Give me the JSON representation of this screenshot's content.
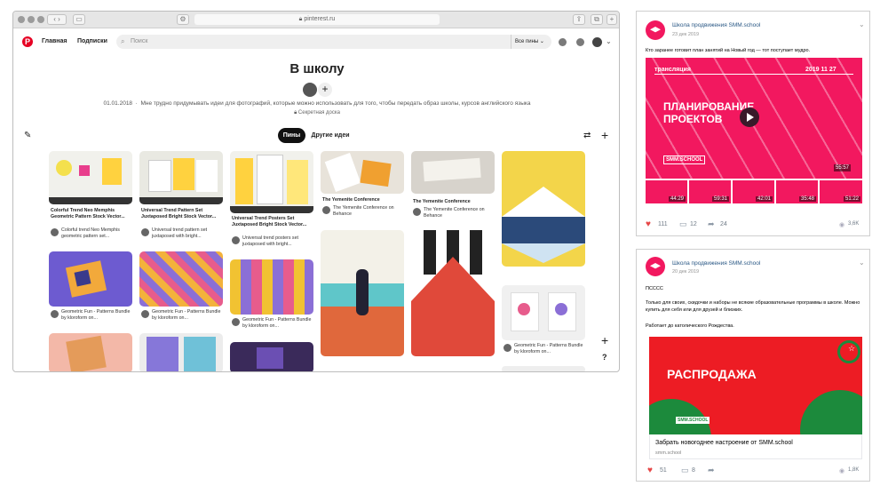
{
  "browser": {
    "url": "pinterest.ru"
  },
  "pinterest": {
    "nav": {
      "home": "Главная",
      "following": "Подписки",
      "search_placeholder": "Поиск",
      "all_pins": "Все пины"
    },
    "board": {
      "title": "В школу",
      "date": "01.01.2018",
      "description": "Мне трудно придумывать идеи для фотографий, которые можно использовать для того, чтобы передать образ школы, курсов английского языка",
      "secret": "Секретная доска"
    },
    "tabs": {
      "pins": "Пины",
      "other": "Другие идеи"
    },
    "help": "?",
    "pins": [
      {
        "title": "Colorful Trend Neo Memphis Geometric Pattern Stock Vector...",
        "sub": "Colorful trend Neo Memphis geometric pattern set..."
      },
      {
        "title": "Universal Trend Pattern Set Juxtaposed Bright Stock Vector...",
        "sub": "Universal trend pattern set juxtaposed with bright..."
      },
      {
        "title": "Universal Trend Posters Set Juxtaposed Bright Stock Vector...",
        "sub": "Universal trend posters set juxtaposed with bright..."
      },
      {
        "title": "The Yemenite Conference",
        "sub": "The Yemenite Conference on Behance"
      },
      {
        "title": "The Yemenite Conference",
        "sub": "The Yemenite Conference on Behance"
      },
      {
        "title": "",
        "sub": "Geometric Fun - Patterns Bundle by kloroform on..."
      },
      {
        "title": "",
        "sub": "Geometric Fun - Patterns Bundle by kloroform on..."
      },
      {
        "title": "",
        "sub": "Geometric Fun - Patterns Bundle by kloroform on..."
      },
      {
        "title": "",
        "sub": "Geometric Fun - Patterns Bundle by kloroform on..."
      }
    ]
  },
  "post1": {
    "author": "Школа продвижения SMM.school",
    "date": "23 дек 2019",
    "text": "Кто заранее готовит план занятий на Новый год — тот поступает мудро.",
    "video": {
      "badge": "трансляция",
      "vdate": "2019 11 27",
      "title1": "ПЛАНИРОВАНИЕ",
      "title2": "ПРОЕКТОВ",
      "logo": "SMM.SCHOOL",
      "duration": "55:57"
    },
    "thumbs": [
      "44:29",
      "59:31",
      "42:01",
      "35:48",
      "51:22"
    ],
    "likes": "111",
    "comments": "12",
    "reposts": "24",
    "views": "3,6K"
  },
  "post2": {
    "author": "Школа продвижения SMM.school",
    "date": "20 дек 2019",
    "line1": "ПСССС",
    "line2": "Только для своих, скидочки и наборы не всякие образовательные программы в школе. Можно купить для себя или для друзей и близких.",
    "line3": "Работает до католического Рождества.",
    "banner": "РАСПРОДАЖА",
    "banner_logo": "SMM.SCHOOL",
    "link_title": "Забрать новогоднее настроение от SMM.school",
    "link_domain": "smm.school",
    "likes": "51",
    "comments": "8",
    "reposts": "",
    "views": "1,8K"
  },
  "colors": {
    "pinterest_red": "#e60023",
    "vk_pink": "#f2185f",
    "vk_blue": "#2a5885",
    "sale_red": "#ed1c24",
    "sale_green": "#1c8a3c"
  }
}
